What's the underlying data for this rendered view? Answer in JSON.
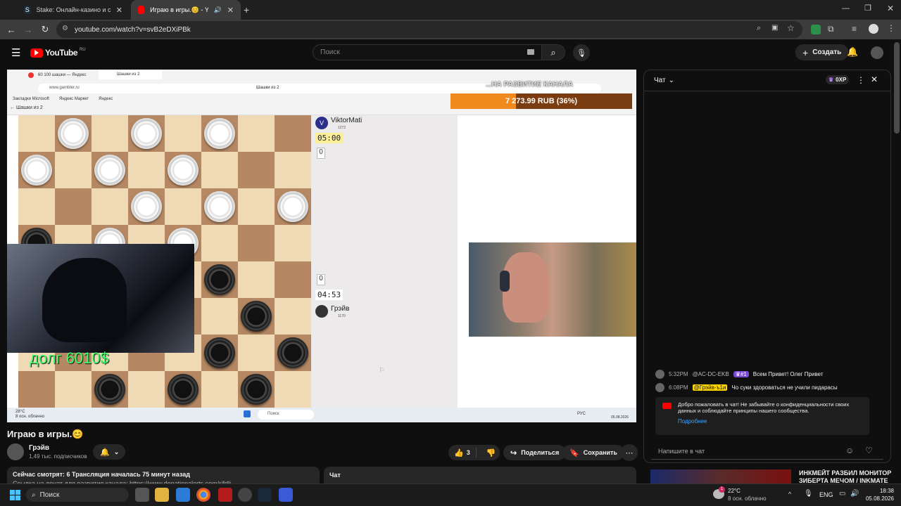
{
  "browser": {
    "tabs": [
      {
        "label": "Stake: Онлайн-казино и ставк..."
      },
      {
        "label": "Играю в игры.😊 - YouTub"
      }
    ],
    "url": "youtube.com/watch?v=svB2eDXiPBk"
  },
  "youtube": {
    "logo": "YouTube",
    "region": "RU",
    "search_placeholder": "Поиск",
    "create_label": "Создать"
  },
  "stream": {
    "inner_tab": "60 100 шашки — Яндекс",
    "inner_tab2": "Шашки из 2",
    "inner_url": "www.gambler.ru",
    "inner_page_title": "Шашки из 2",
    "bookmarks": [
      "Закладки Microsoft",
      "Яндекс Маркет",
      "Яндекс"
    ],
    "back_label": "Шашки из 2",
    "overlay_text": "...НА РАЗВИТИЕ КАНАЛА",
    "donation_progress": "7 273.99 RUB (36%)",
    "donation_fraction": 0.36,
    "opponent_name": "ViktorMati",
    "opponent_rating": "1272",
    "opponent_avatar_letter": "V",
    "opponent_timer": "05:00",
    "opponent_score": "0",
    "player_score": "0",
    "player_timer": "04:53",
    "player_name": "Грэйв",
    "player_rating": "1170",
    "debt_text": "долг 6010$",
    "weather_in": "28°C",
    "weather_in_desc": "8 осн. облачно",
    "taskbar_search": "Поиск",
    "taskbar_date": "05.08.2026",
    "taskbar_lang": "РУС"
  },
  "video": {
    "title": "Играю в игры.😊",
    "channel": "Грэйв",
    "subscribers": "1,49 тыс. подписчиков",
    "likes": "3",
    "share_label": "Поделиться",
    "save_label": "Сохранить",
    "desc_line1": "Сейчас смотрят: 6  Трансляция началась 75 минут назад",
    "desc_line2": "Ссылка на донат для развития канала: https://www.donationalerts.com/r/fdli",
    "chat_tab": "Чат"
  },
  "chat": {
    "title": "Чат",
    "xp": "0XP",
    "messages": [
      {
        "time": "5:32PM",
        "author": "@AC-DC-EKB",
        "badge": "#1",
        "text": "Всем Привет! Олег Привет"
      },
      {
        "time": "6:08PM",
        "author": "@Грэйв-ъ1и",
        "text": "Чо суки здороваться не учили пидарасы"
      }
    ],
    "welcome_text": "Добро пожаловать в чат! Не забывайте о конфиденциальности своих данных и соблюдайте принципы нашего сообщества.",
    "welcome_link": "Подробнее",
    "input_placeholder": "Напишите в чат"
  },
  "recommended": {
    "title": "ИНКМЕЙТ РАЗБИЛ МОНИТОР ЗИБЕРТА МЕЧОМ / INKMATE"
  },
  "windows": {
    "search": "Поиск",
    "temp": "22°C",
    "weather": "8 осн. облачно",
    "lang": "ENG",
    "time": "18:38",
    "date": "05.08.2026",
    "notif_count": "1"
  },
  "board": {
    "rows": [
      [
        "",
        "w",
        "",
        "w",
        "",
        "w",
        "",
        ""
      ],
      [
        "w",
        "",
        "w",
        "",
        "w",
        "",
        "",
        ""
      ],
      [
        "",
        "",
        "",
        "w",
        "",
        "w",
        "",
        "w"
      ],
      [
        "b",
        "",
        "w",
        "",
        "w",
        "",
        "",
        ""
      ],
      [
        "",
        "",
        "",
        "",
        "",
        "b",
        "",
        ""
      ],
      [
        "",
        "",
        "",
        "",
        "",
        "",
        "b",
        ""
      ],
      [
        "",
        "",
        "",
        "",
        "",
        "b",
        "",
        "b"
      ],
      [
        "",
        "",
        "b",
        "",
        "b",
        "",
        "b",
        ""
      ]
    ]
  }
}
